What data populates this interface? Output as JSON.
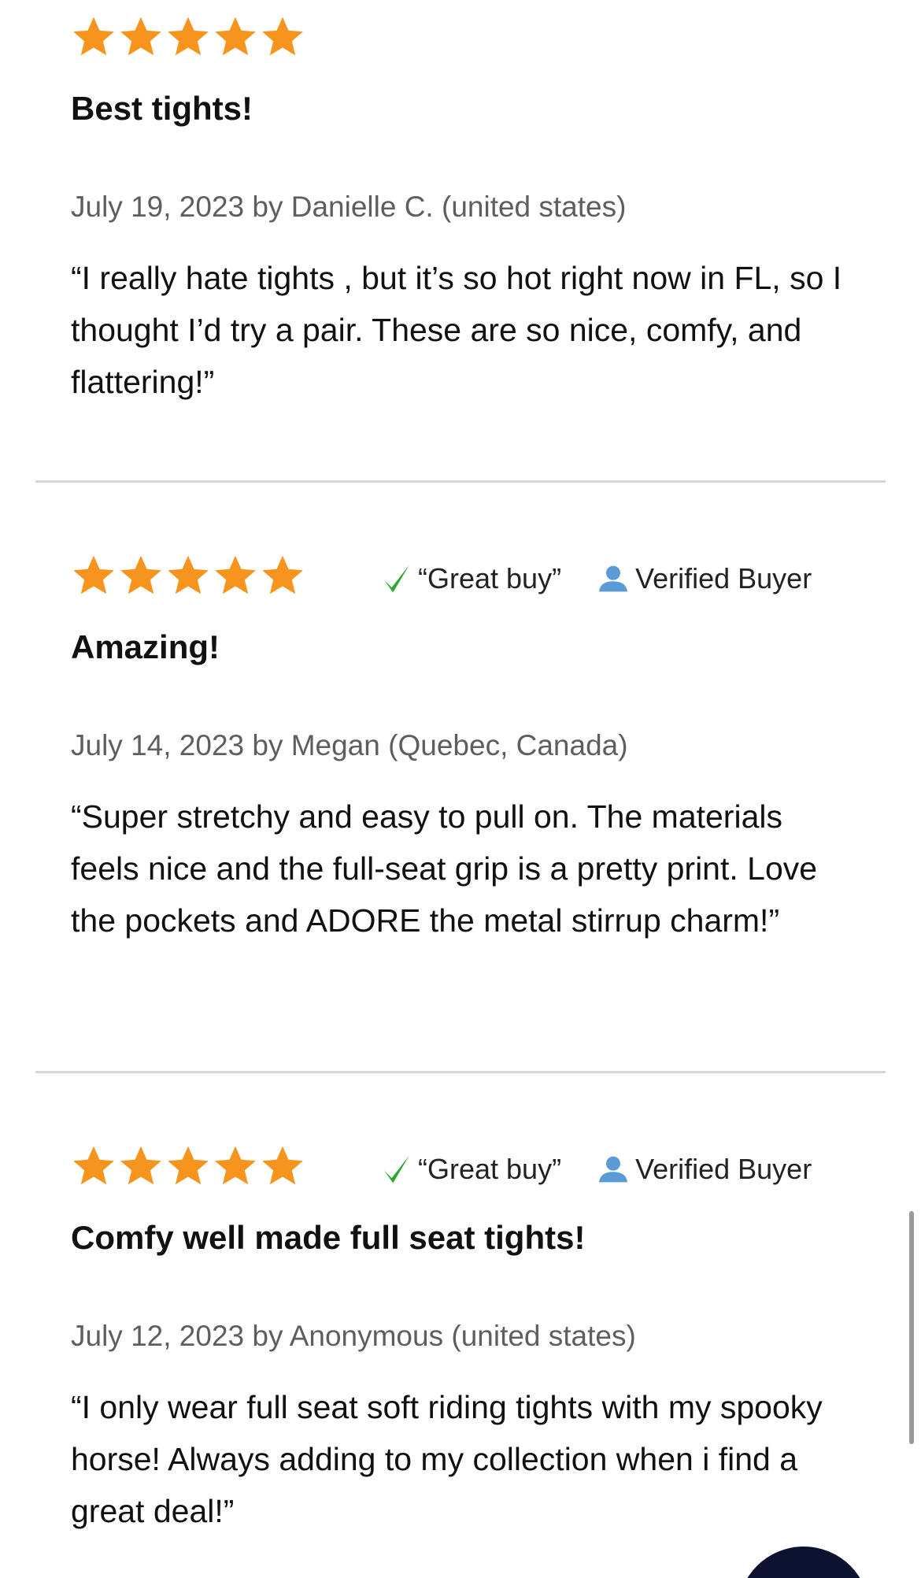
{
  "colors": {
    "star": "#f7941d",
    "check": "#2aa82a",
    "user_icon": "#5b9bd5",
    "meta_text": "#5e5e5e",
    "divider": "#d6d6d6",
    "chat_button": "#0d1130"
  },
  "reviews": [
    {
      "rating": 5,
      "great_buy": "",
      "verified": "",
      "title": "Best tights!",
      "meta": "July 19, 2023 by Danielle C. (united states)",
      "text": "“I really hate tights , but it’s so hot right now in FL, so I thought I’d try a pair. These are so nice, comfy, and flattering!”"
    },
    {
      "rating": 5,
      "great_buy": "“Great buy”",
      "verified": "Verified Buyer",
      "title": "Amazing!",
      "meta": "July 14, 2023 by Megan (Quebec, Canada)",
      "text": "“Super stretchy and easy to pull on. The materials feels nice and the full-seat grip is a pretty print. Love the pockets and ADORE the metal stirrup charm!”"
    },
    {
      "rating": 5,
      "great_buy": "“Great buy”",
      "verified": "Verified Buyer",
      "title": "Comfy well made full seat tights!",
      "meta": "July 12, 2023 by Anonymous (united states)",
      "text": "“I only wear full seat soft riding tights with my spooky horse! Always adding to my collection when i find a great deal!”"
    }
  ],
  "icons": {
    "star": "star-icon",
    "check": "checkmark-icon",
    "user": "user-icon"
  }
}
